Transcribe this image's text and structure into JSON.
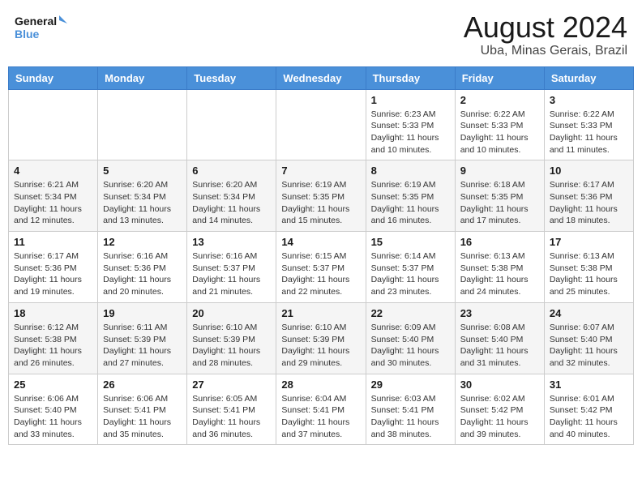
{
  "header": {
    "logo_line1": "General",
    "logo_line2": "Blue",
    "main_title": "August 2024",
    "sub_title": "Uba, Minas Gerais, Brazil"
  },
  "weekdays": [
    "Sunday",
    "Monday",
    "Tuesday",
    "Wednesday",
    "Thursday",
    "Friday",
    "Saturday"
  ],
  "weeks": [
    [
      {
        "day": "",
        "info": ""
      },
      {
        "day": "",
        "info": ""
      },
      {
        "day": "",
        "info": ""
      },
      {
        "day": "",
        "info": ""
      },
      {
        "day": "1",
        "info": "Sunrise: 6:23 AM\nSunset: 5:33 PM\nDaylight: 11 hours\nand 10 minutes."
      },
      {
        "day": "2",
        "info": "Sunrise: 6:22 AM\nSunset: 5:33 PM\nDaylight: 11 hours\nand 10 minutes."
      },
      {
        "day": "3",
        "info": "Sunrise: 6:22 AM\nSunset: 5:33 PM\nDaylight: 11 hours\nand 11 minutes."
      }
    ],
    [
      {
        "day": "4",
        "info": "Sunrise: 6:21 AM\nSunset: 5:34 PM\nDaylight: 11 hours\nand 12 minutes."
      },
      {
        "day": "5",
        "info": "Sunrise: 6:20 AM\nSunset: 5:34 PM\nDaylight: 11 hours\nand 13 minutes."
      },
      {
        "day": "6",
        "info": "Sunrise: 6:20 AM\nSunset: 5:34 PM\nDaylight: 11 hours\nand 14 minutes."
      },
      {
        "day": "7",
        "info": "Sunrise: 6:19 AM\nSunset: 5:35 PM\nDaylight: 11 hours\nand 15 minutes."
      },
      {
        "day": "8",
        "info": "Sunrise: 6:19 AM\nSunset: 5:35 PM\nDaylight: 11 hours\nand 16 minutes."
      },
      {
        "day": "9",
        "info": "Sunrise: 6:18 AM\nSunset: 5:35 PM\nDaylight: 11 hours\nand 17 minutes."
      },
      {
        "day": "10",
        "info": "Sunrise: 6:17 AM\nSunset: 5:36 PM\nDaylight: 11 hours\nand 18 minutes."
      }
    ],
    [
      {
        "day": "11",
        "info": "Sunrise: 6:17 AM\nSunset: 5:36 PM\nDaylight: 11 hours\nand 19 minutes."
      },
      {
        "day": "12",
        "info": "Sunrise: 6:16 AM\nSunset: 5:36 PM\nDaylight: 11 hours\nand 20 minutes."
      },
      {
        "day": "13",
        "info": "Sunrise: 6:16 AM\nSunset: 5:37 PM\nDaylight: 11 hours\nand 21 minutes."
      },
      {
        "day": "14",
        "info": "Sunrise: 6:15 AM\nSunset: 5:37 PM\nDaylight: 11 hours\nand 22 minutes."
      },
      {
        "day": "15",
        "info": "Sunrise: 6:14 AM\nSunset: 5:37 PM\nDaylight: 11 hours\nand 23 minutes."
      },
      {
        "day": "16",
        "info": "Sunrise: 6:13 AM\nSunset: 5:38 PM\nDaylight: 11 hours\nand 24 minutes."
      },
      {
        "day": "17",
        "info": "Sunrise: 6:13 AM\nSunset: 5:38 PM\nDaylight: 11 hours\nand 25 minutes."
      }
    ],
    [
      {
        "day": "18",
        "info": "Sunrise: 6:12 AM\nSunset: 5:38 PM\nDaylight: 11 hours\nand 26 minutes."
      },
      {
        "day": "19",
        "info": "Sunrise: 6:11 AM\nSunset: 5:39 PM\nDaylight: 11 hours\nand 27 minutes."
      },
      {
        "day": "20",
        "info": "Sunrise: 6:10 AM\nSunset: 5:39 PM\nDaylight: 11 hours\nand 28 minutes."
      },
      {
        "day": "21",
        "info": "Sunrise: 6:10 AM\nSunset: 5:39 PM\nDaylight: 11 hours\nand 29 minutes."
      },
      {
        "day": "22",
        "info": "Sunrise: 6:09 AM\nSunset: 5:40 PM\nDaylight: 11 hours\nand 30 minutes."
      },
      {
        "day": "23",
        "info": "Sunrise: 6:08 AM\nSunset: 5:40 PM\nDaylight: 11 hours\nand 31 minutes."
      },
      {
        "day": "24",
        "info": "Sunrise: 6:07 AM\nSunset: 5:40 PM\nDaylight: 11 hours\nand 32 minutes."
      }
    ],
    [
      {
        "day": "25",
        "info": "Sunrise: 6:06 AM\nSunset: 5:40 PM\nDaylight: 11 hours\nand 33 minutes."
      },
      {
        "day": "26",
        "info": "Sunrise: 6:06 AM\nSunset: 5:41 PM\nDaylight: 11 hours\nand 35 minutes."
      },
      {
        "day": "27",
        "info": "Sunrise: 6:05 AM\nSunset: 5:41 PM\nDaylight: 11 hours\nand 36 minutes."
      },
      {
        "day": "28",
        "info": "Sunrise: 6:04 AM\nSunset: 5:41 PM\nDaylight: 11 hours\nand 37 minutes."
      },
      {
        "day": "29",
        "info": "Sunrise: 6:03 AM\nSunset: 5:41 PM\nDaylight: 11 hours\nand 38 minutes."
      },
      {
        "day": "30",
        "info": "Sunrise: 6:02 AM\nSunset: 5:42 PM\nDaylight: 11 hours\nand 39 minutes."
      },
      {
        "day": "31",
        "info": "Sunrise: 6:01 AM\nSunset: 5:42 PM\nDaylight: 11 hours\nand 40 minutes."
      }
    ]
  ]
}
